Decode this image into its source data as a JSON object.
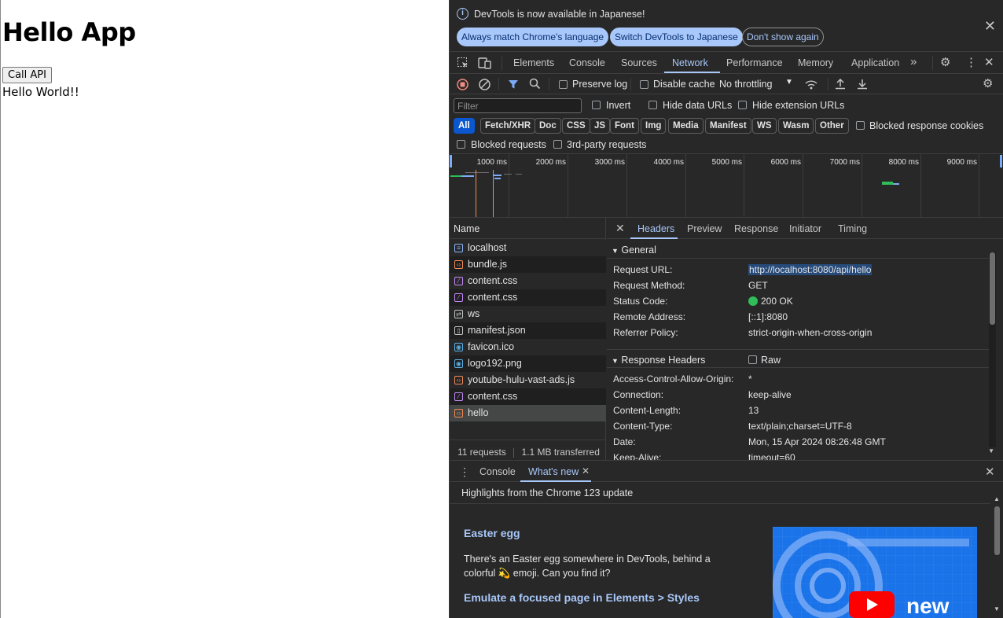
{
  "page": {
    "heading": "Hello App",
    "button_label": "Call API",
    "message": "Hello World!!"
  },
  "devtools": {
    "infobar": {
      "message": "DevTools is now available in Japanese!",
      "btn_match": "Always match Chrome's language",
      "btn_switch": "Switch DevTools to Japanese",
      "btn_dont": "Don't show again"
    },
    "tabs": [
      "Elements",
      "Console",
      "Sources",
      "Network",
      "Performance",
      "Memory",
      "Application"
    ],
    "active_tab": "Network",
    "toolbar": {
      "preserve_log": "Preserve log",
      "disable_cache": "Disable cache",
      "throttling": "No throttling"
    },
    "filter": {
      "placeholder": "Filter",
      "invert": "Invert",
      "hide_data_urls": "Hide data URLs",
      "hide_extension_urls": "Hide extension URLs"
    },
    "types": [
      "All",
      "Fetch/XHR",
      "Doc",
      "CSS",
      "JS",
      "Font",
      "Img",
      "Media",
      "Manifest",
      "WS",
      "Wasm",
      "Other"
    ],
    "blocked_response_cookies": "Blocked response cookies",
    "blocked_requests": "Blocked requests",
    "third_party": "3rd-party requests",
    "timeline_ticks": [
      "1000 ms",
      "2000 ms",
      "3000 ms",
      "4000 ms",
      "5000 ms",
      "6000 ms",
      "7000 ms",
      "8000 ms",
      "9000 ms"
    ],
    "name_header": "Name",
    "requests": [
      {
        "name": "localhost",
        "icon": "document-icon",
        "color": "#8ab4f8"
      },
      {
        "name": "bundle.js",
        "icon": "script-icon",
        "color": "#f28b54"
      },
      {
        "name": "content.css",
        "icon": "stylesheet-icon",
        "color": "#c58af9"
      },
      {
        "name": "content.css",
        "icon": "stylesheet-icon",
        "color": "#c58af9"
      },
      {
        "name": "ws",
        "icon": "websocket-icon",
        "color": "#c4c7c5"
      },
      {
        "name": "manifest.json",
        "icon": "file-icon",
        "color": "#c4c7c5"
      },
      {
        "name": "favicon.ico",
        "icon": "image-icon",
        "color": "#5ab1e8"
      },
      {
        "name": "logo192.png",
        "icon": "image-icon",
        "color": "#5ab1e8"
      },
      {
        "name": "youtube-hulu-vast-ads.js",
        "icon": "script-icon",
        "color": "#f28b54"
      },
      {
        "name": "content.css",
        "icon": "stylesheet-icon",
        "color": "#c58af9"
      },
      {
        "name": "hello",
        "icon": "fetch-icon",
        "color": "#f28b54"
      }
    ],
    "status": {
      "requests": "11 requests",
      "transferred": "1.1 MB transferred"
    },
    "detail_tabs": [
      "Headers",
      "Preview",
      "Response",
      "Initiator",
      "Timing"
    ],
    "general": {
      "title": "General",
      "rows": [
        {
          "key": "Request URL:",
          "value": "http://localhost:8080/api/hello"
        },
        {
          "key": "Request Method:",
          "value": "GET"
        },
        {
          "key": "Status Code:",
          "value": "200 OK"
        },
        {
          "key": "Remote Address:",
          "value": "[::1]:8080"
        },
        {
          "key": "Referrer Policy:",
          "value": "strict-origin-when-cross-origin"
        }
      ]
    },
    "response_headers": {
      "title": "Response Headers",
      "raw_label": "Raw",
      "rows": [
        {
          "key": "Access-Control-Allow-Origin:",
          "value": "*"
        },
        {
          "key": "Connection:",
          "value": "keep-alive"
        },
        {
          "key": "Content-Length:",
          "value": "13"
        },
        {
          "key": "Content-Type:",
          "value": "text/plain;charset=UTF-8"
        },
        {
          "key": "Date:",
          "value": "Mon, 15 Apr 2024 08:26:48 GMT"
        },
        {
          "key": "Keep-Alive:",
          "value": "timeout=60"
        }
      ]
    },
    "drawer": {
      "tabs": [
        "Console",
        "What's new"
      ],
      "highlights": "Highlights from the Chrome 123 update",
      "easter_title": "Easter egg",
      "easter_text": "There's an Easter egg somewhere in DevTools, behind a colorful 💫 emoji. Can you find it?",
      "emulate_title": "Emulate a focused page in Elements > Styles",
      "promo_label": "new"
    },
    "colors": {
      "accent": "#a8c7fa",
      "status_ok": "#2fbd57",
      "background": "#282828"
    }
  }
}
